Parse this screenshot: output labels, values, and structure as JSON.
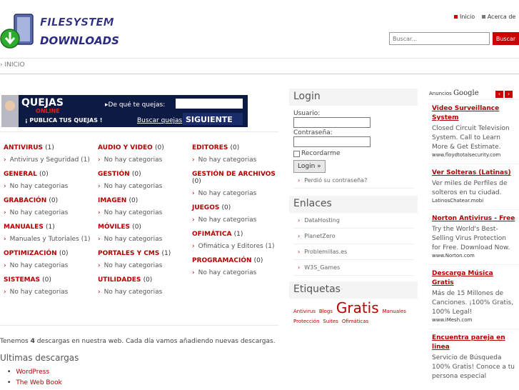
{
  "header": {
    "logo_line1": "FILESYSTEM",
    "logo_line2": "DOWNLOADS",
    "nav": [
      {
        "label": "Inicio",
        "bullet": "red"
      },
      {
        "label": "Acerca de",
        "bullet": "gray"
      }
    ],
    "search_placeholder": "Buscar...",
    "search_button": "Buscar"
  },
  "breadcrumb": "› INICIO",
  "banner": {
    "brand": "QUEJAS",
    "brand_sub": "ONLINE",
    "question": "▸De qué te quejas:",
    "slogan": "¡ PUBLICA TUS QUEJAS !",
    "link": "Buscar quejas",
    "button": "SIGUIENTE"
  },
  "categories": {
    "col1": [
      {
        "title": "ANTIVIRUS",
        "count": "(1)",
        "sub": "Antivirus y Seguridad (1)"
      },
      {
        "title": "GENERAL",
        "count": "(0)",
        "sub": "No hay categorias"
      },
      {
        "title": "GRABACIÓN",
        "count": "(0)",
        "sub": "No hay categorias"
      },
      {
        "title": "MANUALES",
        "count": "(1)",
        "sub": "Manuales y Tutoriales (1)"
      },
      {
        "title": "OPTIMIZACIÓN",
        "count": "(0)",
        "sub": "No hay categorias"
      },
      {
        "title": "SISTEMAS",
        "count": "(0)",
        "sub": "No hay categorias"
      }
    ],
    "col2": [
      {
        "title": "AUDIO Y VIDEO",
        "count": "(0)",
        "sub": "No hay categorias"
      },
      {
        "title": "GESTIÓN",
        "count": "(0)",
        "sub": "No hay categorias"
      },
      {
        "title": "IMAGEN",
        "count": "(0)",
        "sub": "No hay categorias"
      },
      {
        "title": "MÓVILES",
        "count": "(0)",
        "sub": "No hay categorias"
      },
      {
        "title": "PORTALES Y CMS",
        "count": "(1)",
        "sub": "No hay categorias"
      },
      {
        "title": "UTILIDADES",
        "count": "(0)",
        "sub": "No hay categorias"
      }
    ],
    "col3": [
      {
        "title": "EDITORES",
        "count": "(0)",
        "sub": "No hay categorias"
      },
      {
        "title": "GESTIÓN DE ARCHIVOS",
        "count": "(0)",
        "sub": "No hay categorias"
      },
      {
        "title": "JUEGOS",
        "count": "(0)",
        "sub": "No hay categorias"
      },
      {
        "title": "OFIMÁTICA",
        "count": "(1)",
        "sub": "Ofimática y Editores (1)"
      },
      {
        "title": "PROGRAMACIÓN",
        "count": "(0)",
        "sub": "No hay categorias"
      }
    ]
  },
  "stats": {
    "prefix": "Tenemos ",
    "count": "4",
    "suffix": " descargas en nuestra web. Cada día vamos añadiendo nuevas descargas."
  },
  "latest": {
    "title": "Ultimas descargas",
    "items": [
      "WordPress",
      "The Web Book"
    ]
  },
  "login": {
    "title": "Login",
    "user_label": "Usuario:",
    "pass_label": "Contraseña:",
    "remember": "Recordarme",
    "button": "Login »",
    "lost": "Perdió su contraseña?"
  },
  "links": {
    "title": "Enlaces",
    "items": [
      "DataHosting",
      "PlanetZero",
      "Problemillas.es",
      "W3S_Games"
    ]
  },
  "tags": {
    "title": "Etiquetas",
    "items": [
      "Antivirus",
      "Blogs",
      "Gratis",
      "Manuales",
      "Protección",
      "Suites",
      "Ofimáticas"
    ]
  },
  "ads": {
    "label": "Anuncios",
    "brand": "Google",
    "items": [
      {
        "title": "Video Surveillance System",
        "text": "Closed Circuit Television System. Call to Learn More & Get Estimate.",
        "url": "www.floydtotalsecurity.com"
      },
      {
        "title": "Ver Solteras (Latinas)",
        "text": "Ver miles de Perfiles de solteros en tu ciudad.",
        "url": "LatinosChatear.mobi"
      },
      {
        "title": "Norton Antivirus - Free",
        "text": "Try the World's Best-Selling Virus Protection for Free. Download Now.",
        "url": "www.Norton.com"
      },
      {
        "title": "Descarga Música Gratis",
        "text": "Más de 15 Millones de Canciones. ¡100% Gratis, 100% Legal!",
        "url": "www.iMesh.com"
      },
      {
        "title": "Encuentra pareja en linea",
        "text": "Servicio de Búsqueda 100% Gratis! Conoce a tu persona especial",
        "url": ""
      }
    ]
  }
}
